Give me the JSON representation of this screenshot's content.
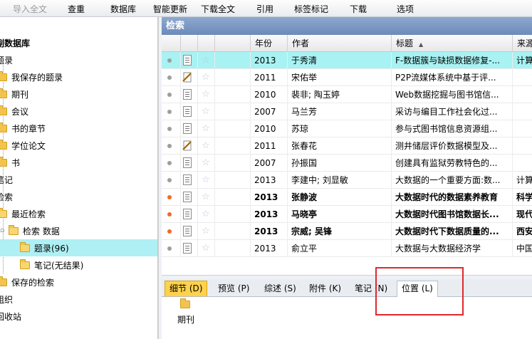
{
  "toolbar": {
    "items": [
      "导入全文",
      "查重",
      "数据库",
      "智能更新",
      "下载全文",
      "引用",
      "标签标记",
      "下载",
      "选项"
    ]
  },
  "tree": {
    "items": [
      {
        "label": "副数据库"
      },
      {
        "label": "题录"
      },
      {
        "label": "我保存的题录"
      },
      {
        "label": "期刊"
      },
      {
        "label": "会议"
      },
      {
        "label": "书的章节"
      },
      {
        "label": "学位论文"
      },
      {
        "label": "书"
      },
      {
        "label": "笔记"
      },
      {
        "label": "检索"
      },
      {
        "label": "最近检索"
      },
      {
        "label": "检索 数据"
      },
      {
        "label": "题录(96)"
      },
      {
        "label": "笔记(无结果)"
      },
      {
        "label": "保存的检索"
      },
      {
        "label": "组织"
      },
      {
        "label": "回收站"
      }
    ]
  },
  "panel": {
    "title": "检索",
    "columns": {
      "year": "年份",
      "author": "作者",
      "title": "标题",
      "source": "来源"
    }
  },
  "rows": [
    {
      "year": "2013",
      "author": "于秀清",
      "title": "F-数据簇与缺损数据修复-...",
      "source": "计算",
      "dot": "gray",
      "icon": "doc",
      "bold": false,
      "highlight": true
    },
    {
      "year": "2011",
      "author": "宋佑举",
      "title": "P2P流媒体系统中基于评...",
      "source": "",
      "dot": "gray",
      "icon": "clip",
      "bold": false,
      "highlight": false
    },
    {
      "year": "2010",
      "author": "裴非; 陶玉婷",
      "title": "Web数据挖掘与图书馆信...",
      "source": "",
      "dot": "gray",
      "icon": "doc",
      "bold": false,
      "highlight": false
    },
    {
      "year": "2007",
      "author": "马兰芳",
      "title": "采访与编目工作社会化过...",
      "source": "",
      "dot": "gray",
      "icon": "doc",
      "bold": false,
      "highlight": false
    },
    {
      "year": "2010",
      "author": "苏琼",
      "title": "参与式图书馆信息资源组...",
      "source": "",
      "dot": "gray",
      "icon": "doc",
      "bold": false,
      "highlight": false
    },
    {
      "year": "2011",
      "author": "张春花",
      "title": "测井储层评价数据模型及...",
      "source": "",
      "dot": "gray",
      "icon": "clip",
      "bold": false,
      "highlight": false
    },
    {
      "year": "2007",
      "author": "孙振国",
      "title": "创建具有监狱劳教特色的...",
      "source": "",
      "dot": "gray",
      "icon": "doc",
      "bold": false,
      "highlight": false
    },
    {
      "year": "2013",
      "author": "李建中; 刘显敏",
      "title": "大数据的一个重要方面:数...",
      "source": "计算",
      "dot": "gray",
      "icon": "doc",
      "bold": false,
      "highlight": false
    },
    {
      "year": "2013",
      "author": "张静波",
      "title": "大数据时代的数据素养教育",
      "source": "科学",
      "dot": "orange",
      "icon": "doc",
      "bold": true,
      "highlight": false
    },
    {
      "year": "2013",
      "author": "马晓亭",
      "title": "大数据时代图书馆数据长...",
      "source": "现代",
      "dot": "orange",
      "icon": "doc",
      "bold": true,
      "highlight": false
    },
    {
      "year": "2013",
      "author": "宗威; 吴锋",
      "title": "大数据时代下数据质量的...",
      "source": "西安",
      "dot": "orange",
      "icon": "doc",
      "bold": true,
      "highlight": false
    },
    {
      "year": "2013",
      "author": "俞立平",
      "title": "大数据与大数据经济学",
      "source": "中国",
      "dot": "gray",
      "icon": "doc",
      "bold": false,
      "highlight": false
    }
  ],
  "tabs": [
    {
      "label": "细节 (D)"
    },
    {
      "label": "预览 (P)"
    },
    {
      "label": "综述 (S)"
    },
    {
      "label": "附件 (K)"
    },
    {
      "label": "笔记 (N)"
    },
    {
      "label": "位置 (L)"
    }
  ],
  "location": {
    "folder_label": "期刊"
  }
}
